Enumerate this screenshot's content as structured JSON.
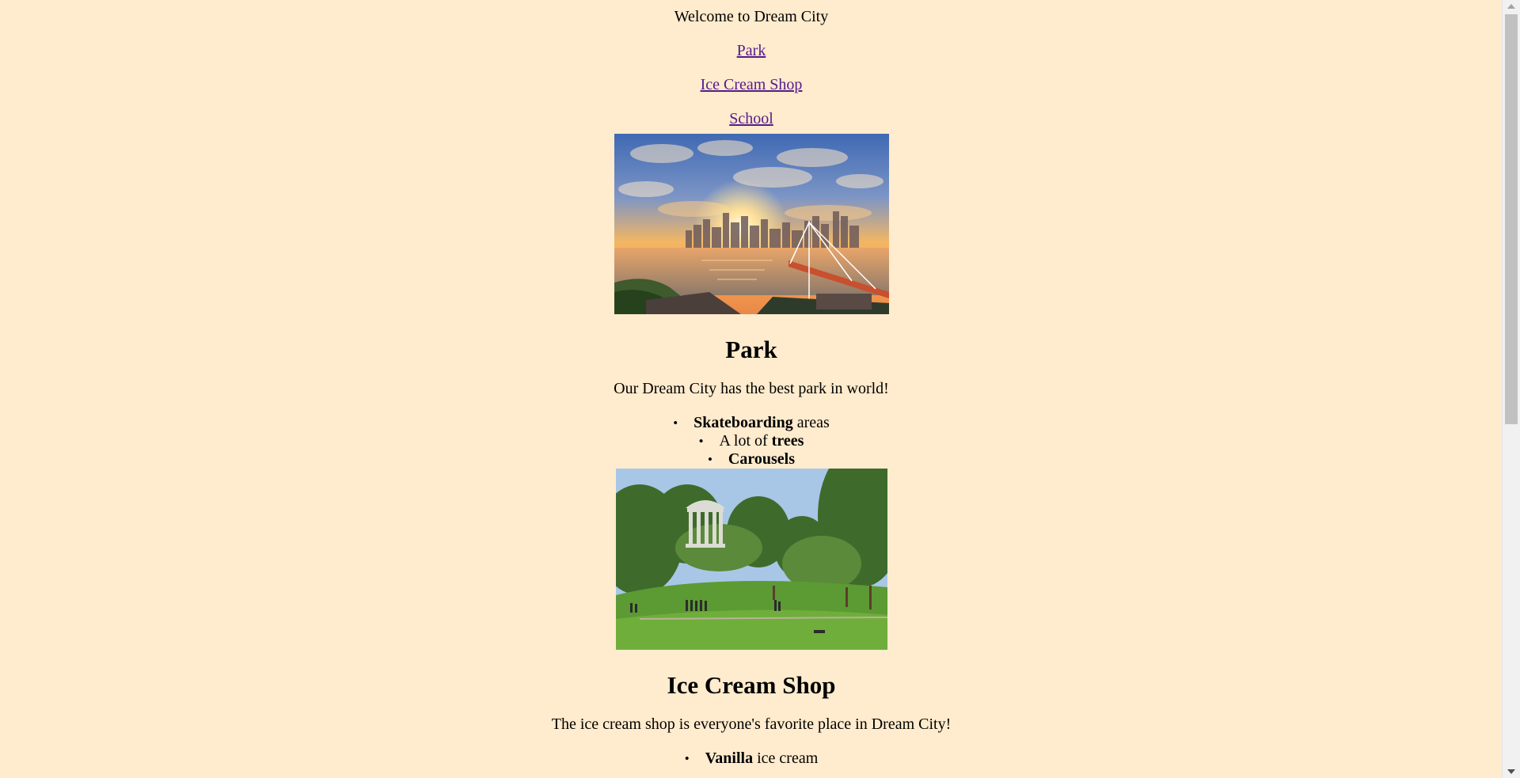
{
  "header": {
    "welcome": "Welcome to Dream City"
  },
  "nav": {
    "park": "Park",
    "ice_cream": "Ice Cream Shop",
    "school": "School"
  },
  "park": {
    "heading": "Park",
    "description": "Our Dream City has the best park in world!",
    "features": [
      {
        "bold": "Skateboarding",
        "rest": " areas"
      },
      {
        "pre": "A lot of ",
        "bold": "trees"
      },
      {
        "bold": "Carousels"
      }
    ]
  },
  "ice_cream": {
    "heading": "Ice Cream Shop",
    "description": "The ice cream shop is everyone's favorite place in Dream City!",
    "features": [
      {
        "bold": "Vanilla",
        "rest": " ice cream"
      }
    ]
  },
  "icons": {
    "bullet": "•"
  },
  "colors": {
    "background": "#ffebcd",
    "link": "#551a8b"
  }
}
